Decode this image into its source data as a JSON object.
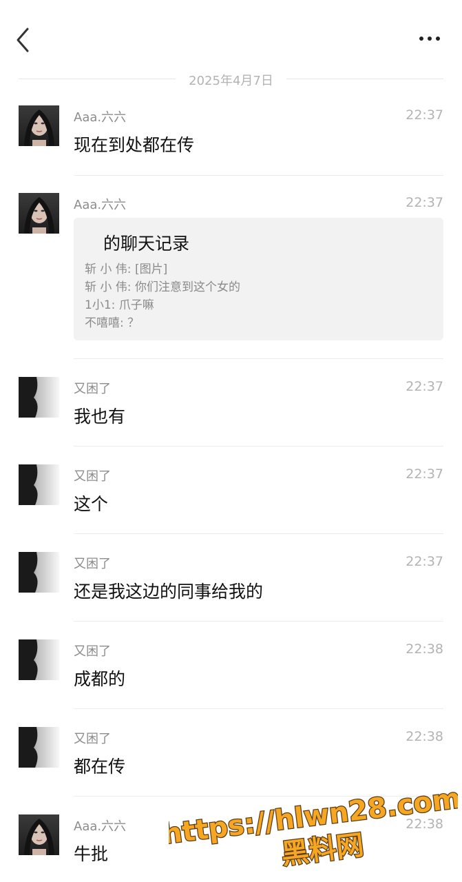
{
  "header": {
    "back_icon": "chevron-left-icon",
    "more_icon": "more-dots-icon"
  },
  "date_divider": "2025年4月7日",
  "messages": [
    {
      "sender": "Aaa.六六",
      "time": "22:37",
      "text": "现在到处都在传",
      "avatar": "avatar-girl"
    },
    {
      "sender": "Aaa.六六",
      "time": "22:37",
      "avatar": "avatar-girl",
      "card": {
        "title": "的聊天记录",
        "lines": [
          "斩 小 伟: [图片]",
          "斩 小 伟: 你们注意到这个女的",
          "1小1: 爪子嘛",
          "不嘻嘻: ？"
        ]
      }
    },
    {
      "sender": "又困了",
      "time": "22:37",
      "text": "我也有",
      "avatar": "avatar-silhouette"
    },
    {
      "sender": "又困了",
      "time": "22:37",
      "text": "这个",
      "avatar": "avatar-silhouette"
    },
    {
      "sender": "又困了",
      "time": "22:37",
      "text": "还是我这边的同事给我的",
      "avatar": "avatar-silhouette"
    },
    {
      "sender": "又困了",
      "time": "22:38",
      "text": "成都的",
      "avatar": "avatar-silhouette"
    },
    {
      "sender": "又困了",
      "time": "22:38",
      "text": "都在传",
      "avatar": "avatar-silhouette"
    },
    {
      "sender": "Aaa.六六",
      "time": "22:38",
      "text": "牛批",
      "avatar": "avatar-girl"
    }
  ],
  "watermark": {
    "url": "https://hlwn28.com",
    "name": "黑料网",
    "color": "#f5a623"
  }
}
